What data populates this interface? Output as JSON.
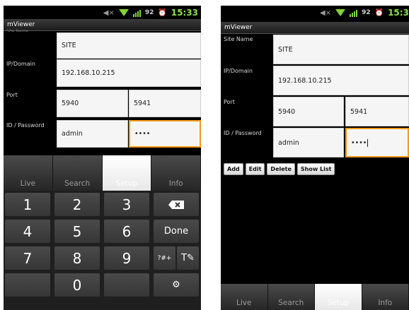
{
  "left": {
    "status": {
      "battery": "92",
      "time": "15:33"
    },
    "app_title": "mViewer",
    "site_name": {
      "label": "Site Name",
      "value": "SITE"
    },
    "ip": {
      "label": "IP/Domain",
      "value": "192.168.10.215"
    },
    "port": {
      "label": "Port",
      "value1": "5940",
      "value2": "5941"
    },
    "credentials": {
      "label": "ID / Password",
      "id": "admin",
      "password": "••••"
    },
    "tabs": [
      "Live",
      "Search",
      "Setup",
      "Info"
    ],
    "selected_tab": "Setup",
    "keypad": {
      "rows": [
        [
          "1",
          "2",
          "3"
        ],
        [
          "4",
          "5",
          "6"
        ],
        [
          "7",
          "8",
          "9"
        ],
        [
          "",
          "0",
          ""
        ]
      ],
      "backspace_icon": "backspace-icon",
      "done_label": "Done",
      "symbols_label": "?#+",
      "handwriting_icon": "handwriting-icon",
      "settings_icon": "gear-icon"
    }
  },
  "right": {
    "status": {
      "battery": "92",
      "time": "15:3"
    },
    "app_title": "mViewer",
    "site_name": {
      "label": "Site Name",
      "value": "SITE"
    },
    "ip": {
      "label": "IP/Domain",
      "value": "192.168.10.215"
    },
    "port": {
      "label": "Port",
      "value1": "5940",
      "value2": "5941"
    },
    "credentials": {
      "label": "ID / Password",
      "id": "admin",
      "password": "••••"
    },
    "buttons": [
      "Add",
      "Edit",
      "Delete",
      "Show List"
    ],
    "tabs": [
      "Live",
      "Search",
      "Setup",
      "Info"
    ],
    "selected_tab": "Setup"
  },
  "colors": {
    "accent": "#f29a1b",
    "status_green": "#8fe04a"
  }
}
